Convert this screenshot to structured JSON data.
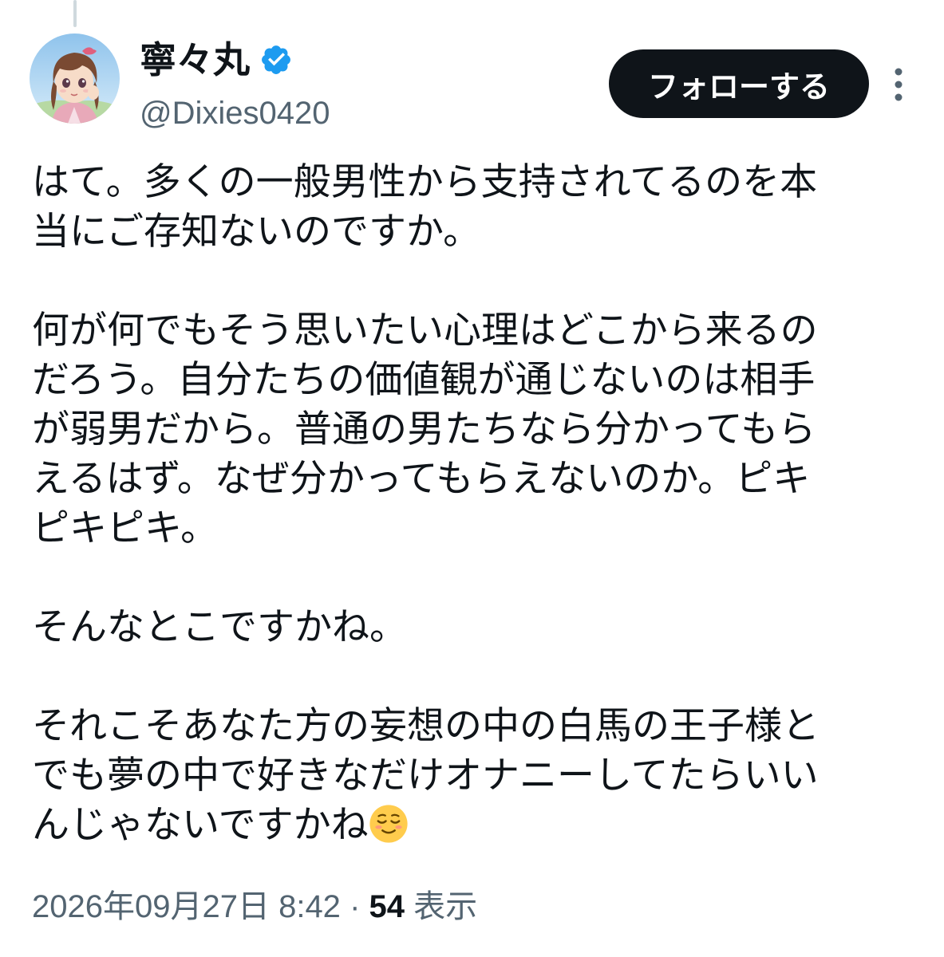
{
  "author": {
    "display_name": "寧々丸",
    "handle": "@Dixies0420",
    "verified": true,
    "avatar_icon": "profile-avatar-anime-girl"
  },
  "actions": {
    "follow_label": "フォローする",
    "more_icon": "more-vertical-icon"
  },
  "post": {
    "paragraphs": [
      "はて。多くの一般男性から支持されてるのを本\n当にご存知ないのですか。",
      "何が何でもそう思いたい心理はどこから来るの\nだろう。自分たちの価値観が通じないのは相手\nが弱男だから。普通の男たちなら分かってもら\nえるはず。なぜ分かってもらえないのか。ピキ\nピキピキ。",
      "そんなとこですかね。",
      "それこそあなた方の妄想の中の白馬の王子様と\nでも夢の中で好きなだけオナニーしてたらいい\nんじゃないですかね"
    ],
    "trailing_emoji": "relieved-face-emoji"
  },
  "meta": {
    "timestamp": "2026年09月27日 8:42",
    "separator": "·",
    "views_count": "54",
    "views_label": "表示"
  },
  "colors": {
    "text_primary": "#0f1419",
    "text_secondary": "#536471",
    "verified_blue": "#1d9bf0",
    "button_bg": "#0f1419",
    "button_text": "#ffffff"
  }
}
